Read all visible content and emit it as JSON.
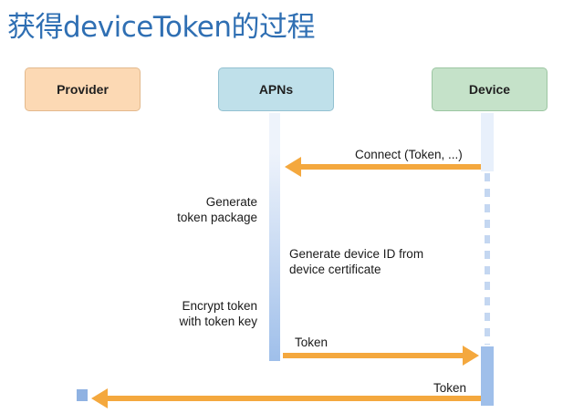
{
  "title": "获得deviceToken的过程",
  "participants": {
    "provider": "Provider",
    "apns": "APNs",
    "device": "Device"
  },
  "messages": {
    "connect": "Connect (Token, ...)",
    "token_to_device": "Token",
    "token_to_provider": "Token"
  },
  "notes": {
    "generate_line1": "Generate",
    "generate_line2": "token package",
    "device_id_line1": "Generate device ID from",
    "device_id_line2": "device certificate",
    "encrypt_line1": "Encrypt token",
    "encrypt_line2": "with token key"
  },
  "colors": {
    "arrow": "#f4a83e",
    "lifeline": "#9dbde6",
    "activation": "#a9c6ee",
    "title": "#2f6fb3"
  }
}
